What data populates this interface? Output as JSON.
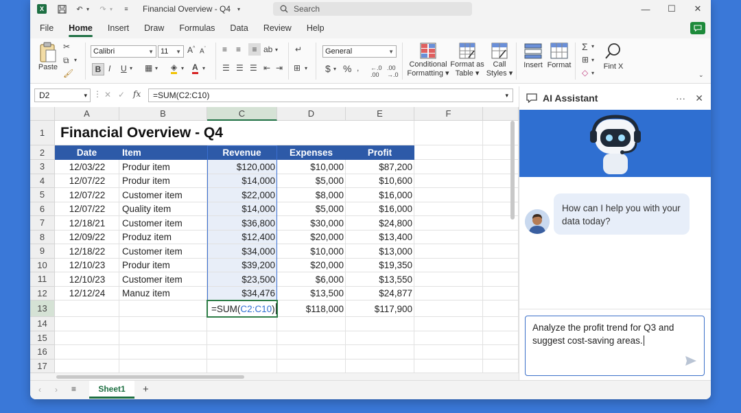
{
  "titlebar": {
    "title": "Financial Overview - Q4",
    "search_placeholder": "Search"
  },
  "menu": [
    "File",
    "Home",
    "Insert",
    "Draw",
    "Formulas",
    "Data",
    "Review",
    "Help"
  ],
  "ribbon": {
    "paste_label": "Paste",
    "font_name": "Calibri",
    "font_size": "11",
    "number_format": "General",
    "conditional_formatting": [
      "Conditional",
      "Formatting"
    ],
    "format_as_table": [
      "Format as",
      "Table"
    ],
    "cell_styles": [
      "Call",
      "Styles"
    ],
    "insert_label": "Insert",
    "format_label": "Format",
    "find_label": "Fint X",
    "bold": "B",
    "italic": "I",
    "underline": "U",
    "currency": "$",
    "percent": "%"
  },
  "formula_bar": {
    "name_box": "D2",
    "fx": "fx",
    "formula": "=SUM(C2:C10)"
  },
  "grid": {
    "columns": [
      "A",
      "B",
      "C",
      "D",
      "E",
      "F"
    ],
    "rows": [
      "1",
      "2",
      "3",
      "4",
      "5",
      "6",
      "7",
      "8",
      "9",
      "10",
      "11",
      "12",
      "13",
      "14",
      "15",
      "16",
      "17"
    ],
    "title": "Financial Overview - Q4",
    "headers": [
      "Date",
      "Item",
      "Revenue",
      "Expenses",
      "Profit"
    ],
    "data": [
      [
        "12/03/22",
        "Produr item",
        "$120,000",
        "$10,000",
        "$87,200"
      ],
      [
        "12/07/22",
        "Produr item",
        "$14,000",
        "$5,000",
        "$10,600"
      ],
      [
        "12/07/22",
        "Customer item",
        "$22,000",
        "$8,000",
        "$16,000"
      ],
      [
        "12/07/22",
        "Quality item",
        "$14,000",
        "$5,000",
        "$16,000"
      ],
      [
        "12/18/21",
        "Customer item",
        "$36,800",
        "$30,000",
        "$24,800"
      ],
      [
        "12/09/22",
        "Produz item",
        "$12,400",
        "$20,000",
        "$13,400"
      ],
      [
        "12/18/22",
        "Customer item",
        "$34,000",
        "$10,000",
        "$13,000"
      ],
      [
        "12/10/23",
        "Produr item",
        "$39,200",
        "$20,000",
        "$19,350"
      ],
      [
        "12/10/23",
        "Customer item",
        "$23,500",
        "$6,000",
        "$13,550"
      ],
      [
        "12/12/24",
        "Manuz item",
        "$34,476",
        "$13,500",
        "$24,877"
      ]
    ],
    "totals": {
      "formula_prefix": "=SUM(",
      "formula_range": "C2:C10",
      "formula_suffix": ")",
      "expenses": "$118,000",
      "profit": "$117,900"
    }
  },
  "sheet_tabs": {
    "active": "Sheet1"
  },
  "assistant": {
    "title": "AI Assistant",
    "greeting": "How can I help you with your data today?",
    "input_text": "Analyze the profit trend for Q3 and suggest cost-saving areas."
  },
  "colors": {
    "header_blue": "#2d5aa8",
    "excel_green": "#1d6f42",
    "banner_blue": "#2f6fd1",
    "background": "#3a78d8"
  }
}
